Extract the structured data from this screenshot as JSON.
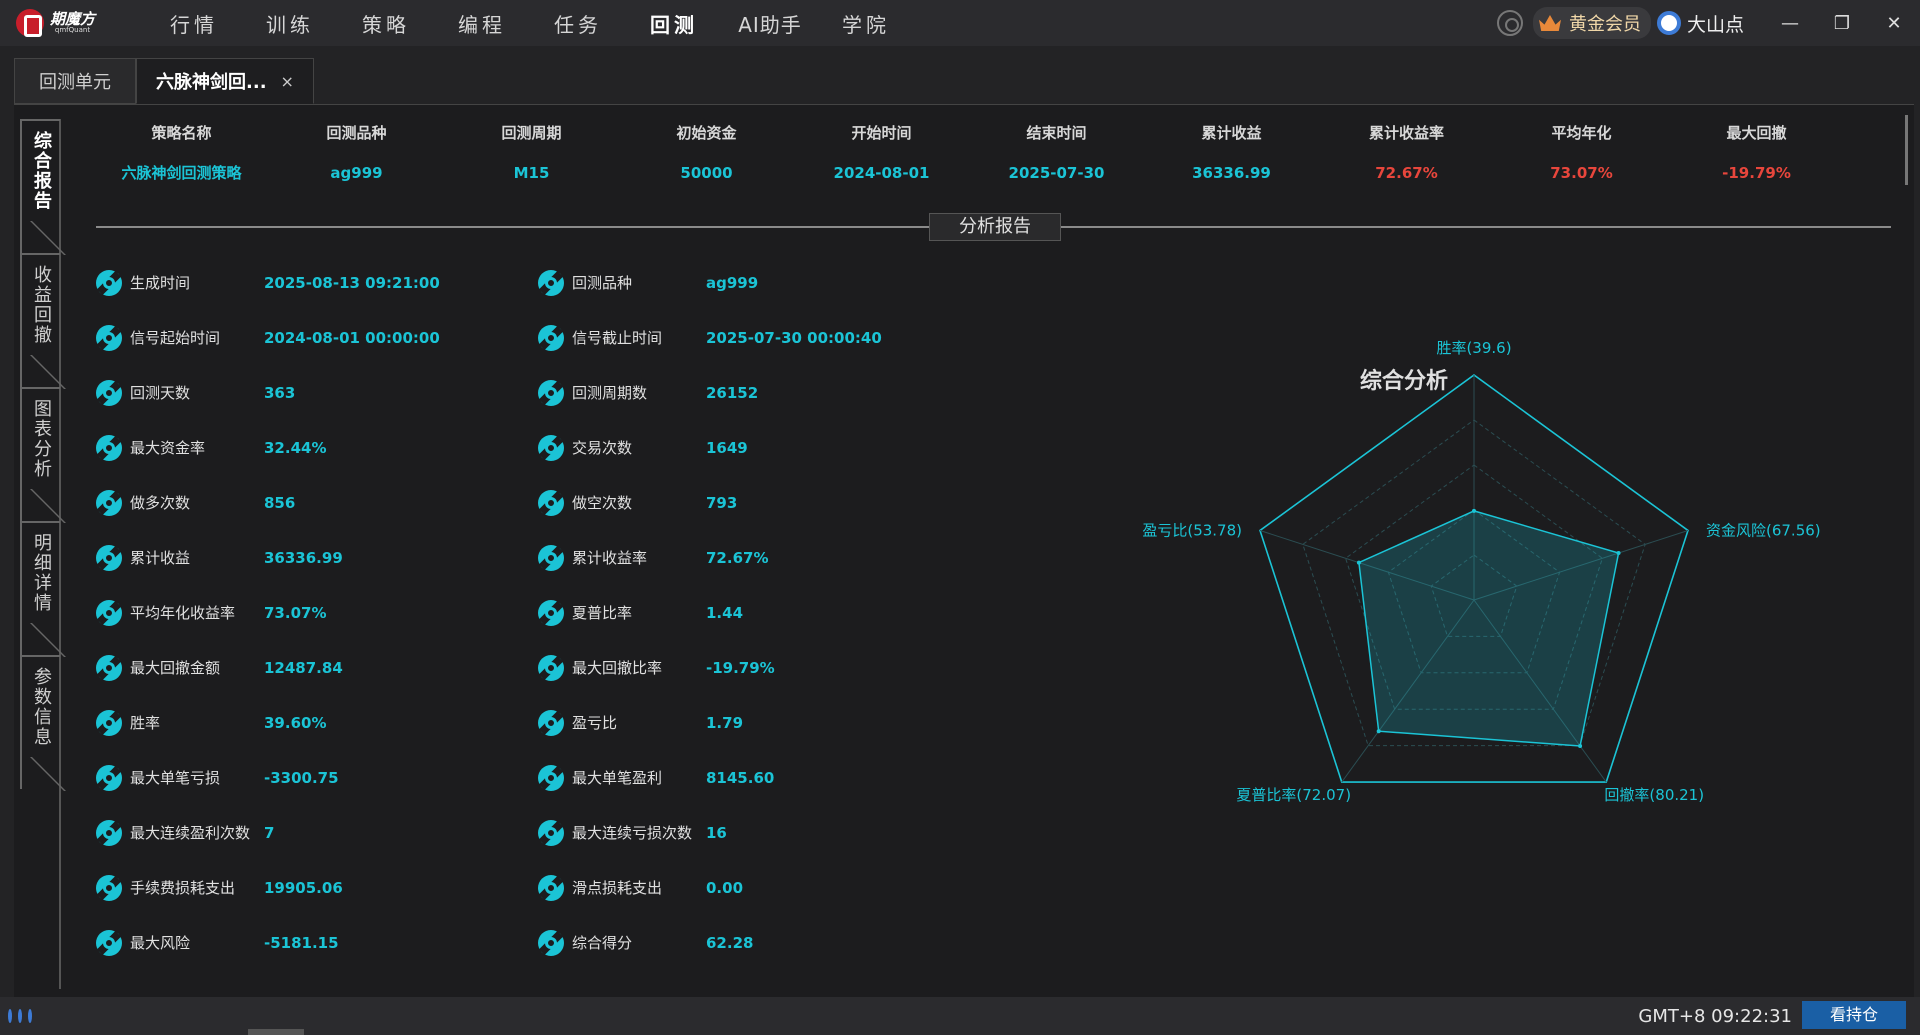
{
  "app": {
    "logo_name": "期魔方",
    "logo_sub": "qmfQuant"
  },
  "nav": [
    "行情",
    "训练",
    "策略",
    "编程",
    "任务",
    "回测",
    "AI助手",
    "学院"
  ],
  "nav_active": "回测",
  "top_right": {
    "member": "黄金会员",
    "username": "大山点",
    "minimize": "—",
    "restore": "❐",
    "close": "✕"
  },
  "tabs": [
    {
      "label": "回测单元"
    },
    {
      "label": "六脉神剑回...",
      "close": "×"
    }
  ],
  "side_tabs": [
    "综合报告",
    "收益回撤",
    "图表分析",
    "明细详情",
    "参数信息"
  ],
  "summary": {
    "headers": [
      "策略名称",
      "回测品种",
      "回测周期",
      "初始资金",
      "开始时间",
      "结束时间",
      "累计收益",
      "累计收益率",
      "平均年化",
      "最大回撤"
    ],
    "values": [
      "六脉神剑回测策略",
      "ag999",
      "M15",
      "50000",
      "2024-08-01",
      "2025-07-30",
      "36336.99",
      "72.67%",
      "73.07%",
      "-19.79%"
    ]
  },
  "section_title": "分析报告",
  "metrics": [
    [
      {
        "label": "生成时间",
        "value": "2025-08-13 09:21:00"
      },
      {
        "label": "回测品种",
        "value": "ag999"
      }
    ],
    [
      {
        "label": "信号起始时间",
        "value": "2024-08-01 00:00:00"
      },
      {
        "label": "信号截止时间",
        "value": "2025-07-30 00:00:40"
      }
    ],
    [
      {
        "label": "回测天数",
        "value": "363"
      },
      {
        "label": "回测周期数",
        "value": "26152"
      }
    ],
    [
      {
        "label": "最大资金率",
        "value": "32.44%"
      },
      {
        "label": "交易次数",
        "value": "1649"
      }
    ],
    [
      {
        "label": "做多次数",
        "value": "856"
      },
      {
        "label": "做空次数",
        "value": "793"
      }
    ],
    [
      {
        "label": "累计收益",
        "value": "36336.99"
      },
      {
        "label": "累计收益率",
        "value": "72.67%"
      }
    ],
    [
      {
        "label": "平均年化收益率",
        "value": "73.07%"
      },
      {
        "label": "夏普比率",
        "value": "1.44"
      }
    ],
    [
      {
        "label": "最大回撤金额",
        "value": "12487.84"
      },
      {
        "label": "最大回撤比率",
        "value": "-19.79%"
      }
    ],
    [
      {
        "label": "胜率",
        "value": "39.60%"
      },
      {
        "label": "盈亏比",
        "value": "1.79"
      }
    ],
    [
      {
        "label": "最大单笔亏损",
        "value": "-3300.75"
      },
      {
        "label": "最大单笔盈利",
        "value": "8145.60"
      }
    ],
    [
      {
        "label": "最大连续盈利次数",
        "value": "7"
      },
      {
        "label": "最大连续亏损次数",
        "value": "16"
      }
    ],
    [
      {
        "label": "手续费损耗支出",
        "value": "19905.06"
      },
      {
        "label": "滑点损耗支出",
        "value": "0.00"
      }
    ],
    [
      {
        "label": "最大风险",
        "value": "-5181.15"
      },
      {
        "label": "综合得分",
        "value": "62.28"
      }
    ]
  ],
  "chart_data": {
    "type": "radar",
    "title": "综合分析",
    "categories": [
      "胜率(39.6)",
      "资金风险(67.56)",
      "回撤率(80.21)",
      "夏普比率(72.07)",
      "盈亏比(53.78)"
    ],
    "values": [
      39.6,
      67.56,
      80.21,
      72.07,
      53.78
    ],
    "max": 100,
    "color": "#1bc4d6"
  },
  "status": {
    "time": "GMT+8 09:22:31",
    "button": "看持仓"
  },
  "colors": {
    "accent": "#1bc4d6",
    "negative": "#e8463c",
    "button": "#1a5fa5"
  }
}
